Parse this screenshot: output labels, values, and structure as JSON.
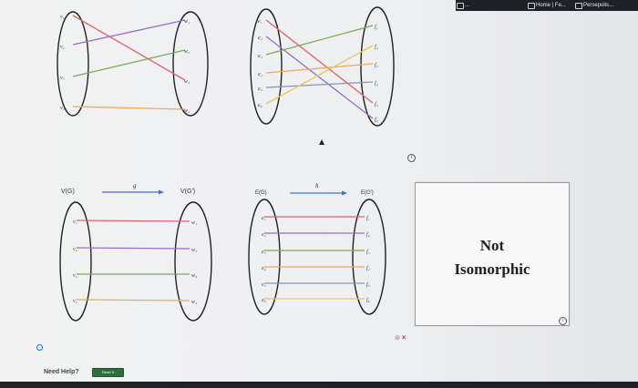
{
  "browser": {
    "tabs": [
      {
        "label": "..."
      },
      {
        "label": "Home | Fe..."
      },
      {
        "label": "Persepolis..."
      }
    ]
  },
  "diagrams": {
    "top_left": {
      "left_labels": [
        "v₁",
        "v₂",
        "v₃",
        "v₄"
      ],
      "right_labels": [
        "w₁",
        "w₂",
        "w₃",
        "w₄"
      ]
    },
    "top_right": {
      "left_labels": [
        "e₁",
        "e₂",
        "e₃",
        "e₄",
        "e₅",
        "e₆"
      ],
      "right_labels": [
        "f₁",
        "f₂",
        "f₃",
        "f₄",
        "f₅",
        "f₆"
      ]
    },
    "bottom_left": {
      "domain_label": "V(G)",
      "map_label": "g",
      "codomain_label": "V(G′)",
      "left_labels": [
        "v₁",
        "v₂",
        "v₃",
        "v₄"
      ],
      "right_labels": [
        "w₁",
        "w₂",
        "w₃",
        "w₄"
      ]
    },
    "bottom_right": {
      "domain_label": "E(G)",
      "map_label": "h",
      "codomain_label": "E(G′)",
      "left_labels": [
        "e₁",
        "e₂",
        "e₃",
        "e₄",
        "e₅",
        "e₆"
      ],
      "right_labels": [
        "f₁",
        "f₂",
        "f₃",
        "f₄",
        "f₅",
        "f₆"
      ]
    }
  },
  "answer": {
    "line1": "Not",
    "line2": "Isomorphic",
    "status_check": "⊘",
    "status_x": "×"
  },
  "help": {
    "label": "Need Help?",
    "read_button": "Read It"
  },
  "colors": {
    "red": "#e0626b",
    "purple": "#9a6cc6",
    "green": "#7bab5a",
    "orange": "#f0a860",
    "gray_blue": "#8a94b8",
    "yellow": "#e9c75a",
    "read_button_bg": "#2f6e3c"
  }
}
